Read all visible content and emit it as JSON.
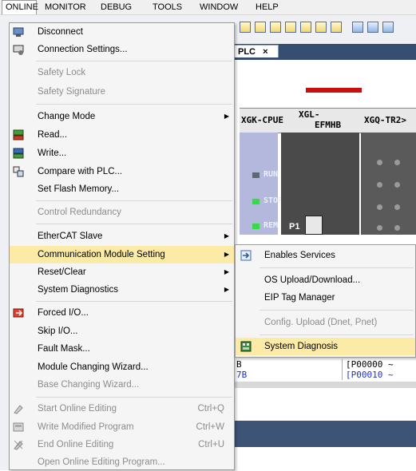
{
  "menubar": {
    "items": [
      "ONLINE",
      "MONITOR",
      "DEBUG",
      "TOOLS",
      "WINDOW",
      "HELP"
    ]
  },
  "document_tab": {
    "label": "PLC",
    "close": "×"
  },
  "rack": {
    "slots": [
      "XGK-CPUE",
      "XGL-",
      "EFMHB",
      "XGQ-TR2>"
    ],
    "leds": [
      "RUN",
      "STOP",
      "REM"
    ],
    "port_label": "P1"
  },
  "online_menu": {
    "items": [
      {
        "label": "Disconnect",
        "icon": "disconnect-icon"
      },
      {
        "label": "Connection Settings...",
        "icon": "connection-settings-icon"
      },
      {
        "label": "Safety Lock",
        "disabled": true
      },
      {
        "label": "Safety Signature",
        "disabled": true
      },
      {
        "label": "Change Mode",
        "submenu": true
      },
      {
        "label": "Read...",
        "icon": "read-icon"
      },
      {
        "label": "Write...",
        "icon": "write-icon"
      },
      {
        "label": "Compare with PLC...",
        "icon": "compare-icon"
      },
      {
        "label": "Set Flash Memory..."
      },
      {
        "label": "Control Redundancy",
        "disabled": true
      },
      {
        "label": "EtherCAT Slave",
        "submenu": true
      },
      {
        "label": "Communication Module Setting",
        "submenu": true,
        "highlighted": true
      },
      {
        "label": "Reset/Clear",
        "submenu": true
      },
      {
        "label": "System Diagnostics",
        "submenu": true
      },
      {
        "label": "Forced I/O...",
        "icon": "forced-io-icon"
      },
      {
        "label": "Skip I/O..."
      },
      {
        "label": "Fault Mask..."
      },
      {
        "label": "Module Changing Wizard..."
      },
      {
        "label": "Base Changing Wizard...",
        "disabled": true
      },
      {
        "label": "Start Online Editing",
        "shortcut": "Ctrl+Q",
        "disabled": true,
        "icon": "start-online-edit-icon"
      },
      {
        "label": "Write Modified Program",
        "shortcut": "Ctrl+W",
        "disabled": true,
        "icon": "write-modified-icon"
      },
      {
        "label": "End Online Editing",
        "shortcut": "Ctrl+U",
        "disabled": true,
        "icon": "end-online-edit-icon"
      },
      {
        "label": "Open Online Editing Program...",
        "disabled": true
      }
    ]
  },
  "comm_submenu": {
    "items": [
      {
        "label": "Enables Services",
        "icon": "enable-services-icon"
      },
      {
        "label": "OS Upload/Download..."
      },
      {
        "label": "EIP Tag Manager"
      },
      {
        "label": "Config. Upload (Dnet, Pnet)",
        "disabled": true
      },
      {
        "label": "System Diagnosis",
        "icon": "system-diagnosis-icon",
        "highlighted": true
      }
    ]
  },
  "lower_panel": {
    "rows": [
      {
        "a": "B",
        "b": "[P00000 ~"
      },
      {
        "a": "7B",
        "b": "[P00010 ~"
      }
    ]
  },
  "colors": {
    "menu_highlight": "#fbeba6",
    "menu_bg": "#f5f5f5",
    "tabstrip": "#364e70",
    "cpu_slot": "#b4b8dc",
    "led_green": "#3cd84c"
  }
}
